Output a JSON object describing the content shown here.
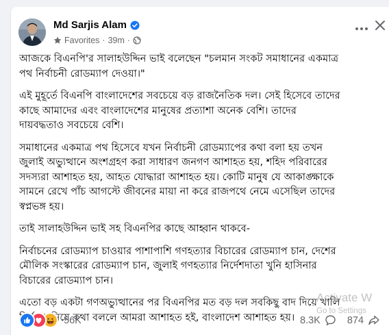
{
  "post": {
    "author_name": "Md Sarjis Alam",
    "favorites_label": "Favorites",
    "time": "39m",
    "paragraphs": [
      "আজকে বিএনপি'র সালাহউদ্দিন ভাই বলেছেন \"চলমান সংকট সমাধানের একমাত্র\nপথ নির্বাচনী রোডম্যাপ দেওয়া।\"",
      "এই মুহূর্তে বিএনপি বাংলাদেশের সবচেয়ে বড় রাজনৈতিক দল। সেই হিসেবে তাদের\nকাছে আমাদের এবং বাংলাদেশের মানুষের প্রত্যাশা অনেক বেশি। তাদের\nদায়বদ্ধতাও সবচেয়ে বেশি।",
      "সমাধানের একমাত্র পথ হিসেবে যখন নির্বাচনী রোডম্যাপের কথা বলা হয় তখন\nজুলাই অভ্যুত্থানে অংশগ্রহণ করা সাধারণ জনগণ আশাহত হয়, শহিদ পরিবারের\nসদস্যরা আশাহত হয়, আহত যোদ্ধারা আশাহত হয়। কোটি মানুষ যে আকাঙ্ক্ষাকে\nসামনে রেখে পাঁচ আগস্টে জীবনের মায়া না করে রাজপথে নেমে এসেছিল তাদের\nস্বপ্নভঙ্গ হয়।",
      "তাই সালাহউদ্দিন ভাই সহ বিএনপির কাছে আহ্বান থাকবে-",
      "নির্বাচনের রোডম্যাপ চাওয়ার পাশাপাশি গণহত্যার বিচারের রোডম্যাপ চান, দেশের\nমৌলিক সংস্কারের রোডম্যাপ চান, জুলাই গণহত্যার নির্দেশদাতা খুনি হাসিনার\nবিচারের রোডম্যাপ চান।",
      "এতো বড় একটা গণঅভ্যুত্থানের পর বিএনপির মত বড় দল সবকিছু বাদ দিয়ে খালি\nনির্বাচন নিয়ে কথা বললে আমরা আশাহত হই, বাংলাদেশ আশাহত হয়।"
    ],
    "reaction_count": "56K",
    "comment_count": "8.3K",
    "share_count": "874"
  },
  "watermark": {
    "title": "Activate W",
    "subtitle": "Go to Settings"
  },
  "colors": {
    "brand_blue": "#1877f2",
    "like_blue": "#1877f2",
    "love_red": "#f33e58",
    "haha_yellow": "#f7b125",
    "text": "#050505",
    "secondary": "#65676b"
  },
  "icons": [
    "verified-badge-icon",
    "star-icon",
    "globe-icon",
    "more-options-icon",
    "close-icon",
    "like-reaction-icon",
    "love-reaction-icon",
    "haha-reaction-icon",
    "comment-icon",
    "share-icon"
  ]
}
